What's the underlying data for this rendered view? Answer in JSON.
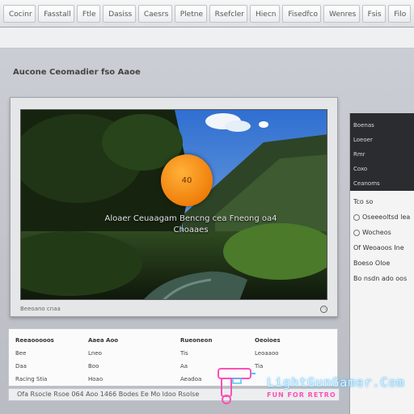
{
  "menubar": {
    "tabs": [
      "Cocinr",
      "Fasstall",
      "Ftle",
      "Dasiss",
      "Caesrs",
      "Pletne",
      "Rsefcler",
      "Hiecn",
      "Fisedfco",
      "Wenres",
      "Fsis",
      "Filo"
    ]
  },
  "page": {
    "heading": "Aucone Ceomadier fso Aaoe"
  },
  "video": {
    "play_label": "40",
    "caption_line1": "Aloaer Ceuaagam Bencng cea Fneong oa4",
    "caption_line2": "Choaaes",
    "footer_left": "Beeoano cnaa"
  },
  "side_panel": {
    "dark_items": [
      "Boenas",
      "Loeoer",
      "Rmr",
      "Coxo",
      "Ceanoms"
    ],
    "items": [
      {
        "label": "Tco so",
        "radio": false
      },
      {
        "label": "Oseeeoltsd lea",
        "radio": true
      },
      {
        "label": "Wocheos",
        "radio": true
      },
      {
        "label": "Of Weoaoos Ine",
        "radio": false
      },
      {
        "label": "Boeso Oloe",
        "radio": false
      },
      {
        "label": "Bo nsdn ado oos",
        "radio": false
      }
    ]
  },
  "info_panel": {
    "columns": [
      {
        "header": "Reeaooooos",
        "cells": [
          "Bee",
          "Daa",
          "Racing Stia"
        ]
      },
      {
        "header": "Aaea Aoo",
        "cells": [
          "Lneo",
          "Boo",
          "Hoao"
        ]
      },
      {
        "header": "Rueoneon",
        "cells": [
          "Tis",
          "Aa",
          "Aeadoa"
        ]
      },
      {
        "header": "Oeoioes",
        "cells": [
          "Leoaaoo",
          "Tia",
          ""
        ]
      }
    ]
  },
  "statusbar": {
    "text": "Ofa Rsocle Rsoe 064 Aoo 1466 Bodes Ee Mo ldoo Rsolse"
  },
  "watermark": {
    "brand": "LightGunGamer.Com",
    "tagline": "FUN FOR RETRO"
  },
  "colors": {
    "orange_button": "#f07f0a",
    "dark_panel": "#2a2c30",
    "watermark_pink": "#ff4fb8",
    "watermark_blue": "#4fc3ff"
  }
}
